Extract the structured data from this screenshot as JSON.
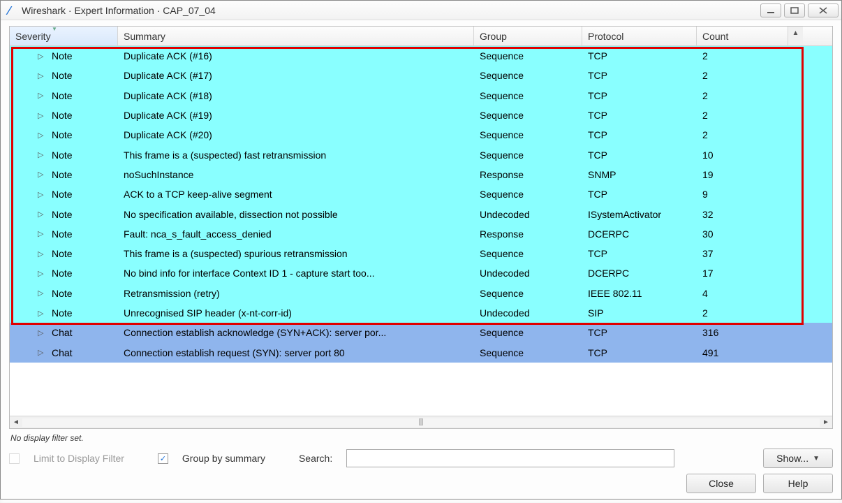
{
  "window": {
    "title": "Wireshark · Expert Information · CAP_07_04"
  },
  "columns": {
    "severity": "Severity",
    "summary": "Summary",
    "group": "Group",
    "protocol": "Protocol",
    "count": "Count"
  },
  "rows": [
    {
      "sev": "Note",
      "sum": "Duplicate ACK (#16)",
      "grp": "Sequence",
      "prot": "TCP",
      "cnt": "2",
      "cls": "note"
    },
    {
      "sev": "Note",
      "sum": "Duplicate ACK (#17)",
      "grp": "Sequence",
      "prot": "TCP",
      "cnt": "2",
      "cls": "note"
    },
    {
      "sev": "Note",
      "sum": "Duplicate ACK (#18)",
      "grp": "Sequence",
      "prot": "TCP",
      "cnt": "2",
      "cls": "note"
    },
    {
      "sev": "Note",
      "sum": "Duplicate ACK (#19)",
      "grp": "Sequence",
      "prot": "TCP",
      "cnt": "2",
      "cls": "note"
    },
    {
      "sev": "Note",
      "sum": "Duplicate ACK (#20)",
      "grp": "Sequence",
      "prot": "TCP",
      "cnt": "2",
      "cls": "note"
    },
    {
      "sev": "Note",
      "sum": "This frame is a (suspected) fast retransmission",
      "grp": "Sequence",
      "prot": "TCP",
      "cnt": "10",
      "cls": "note"
    },
    {
      "sev": "Note",
      "sum": "noSuchInstance",
      "grp": "Response",
      "prot": "SNMP",
      "cnt": "19",
      "cls": "note"
    },
    {
      "sev": "Note",
      "sum": "ACK to a TCP keep-alive segment",
      "grp": "Sequence",
      "prot": "TCP",
      "cnt": "9",
      "cls": "note"
    },
    {
      "sev": "Note",
      "sum": "No specification available, dissection not possible",
      "grp": "Undecoded",
      "prot": "ISystemActivator",
      "cnt": "32",
      "cls": "note"
    },
    {
      "sev": "Note",
      "sum": "Fault: nca_s_fault_access_denied",
      "grp": "Response",
      "prot": "DCERPC",
      "cnt": "30",
      "cls": "note"
    },
    {
      "sev": "Note",
      "sum": "This frame is a (suspected) spurious retransmission",
      "grp": "Sequence",
      "prot": "TCP",
      "cnt": "37",
      "cls": "note"
    },
    {
      "sev": "Note",
      "sum": "No bind info for interface Context ID 1 - capture start too...",
      "grp": "Undecoded",
      "prot": "DCERPC",
      "cnt": "17",
      "cls": "note"
    },
    {
      "sev": "Note",
      "sum": "Retransmission (retry)",
      "grp": "Sequence",
      "prot": "IEEE 802.11",
      "cnt": "4",
      "cls": "note"
    },
    {
      "sev": "Note",
      "sum": "Unrecognised SIP header (x-nt-corr-id)",
      "grp": "Undecoded",
      "prot": "SIP",
      "cnt": "2",
      "cls": "note"
    },
    {
      "sev": "Chat",
      "sum": "Connection establish acknowledge (SYN+ACK): server por...",
      "grp": "Sequence",
      "prot": "TCP",
      "cnt": "316",
      "cls": "chat"
    },
    {
      "sev": "Chat",
      "sum": "Connection establish request (SYN): server port 80",
      "grp": "Sequence",
      "prot": "TCP",
      "cnt": "491",
      "cls": "chat"
    }
  ],
  "status": "No display filter set.",
  "controls": {
    "limit_label": "Limit to Display Filter",
    "group_label": "Group by summary",
    "search_label": "Search:",
    "show_label": "Show...",
    "close_label": "Close",
    "help_label": "Help"
  }
}
